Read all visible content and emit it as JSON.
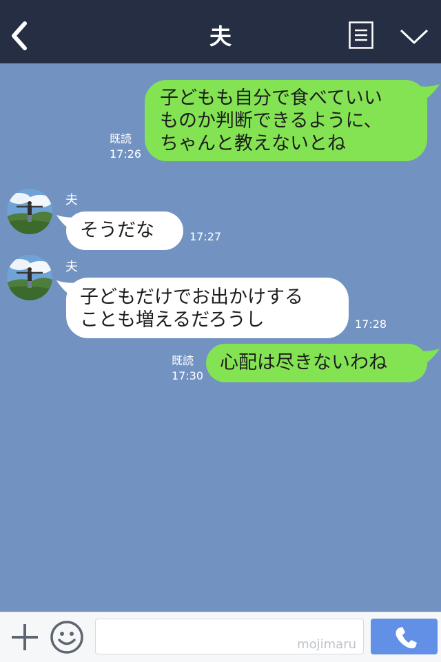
{
  "header": {
    "title": "夫",
    "icons": [
      "back-chevron-icon",
      "menu-list-icon",
      "chevron-down-icon"
    ]
  },
  "messages": [
    {
      "direction": "sent",
      "lines": [
        "子どもも自分で食べていい",
        "ものか判断できるように、",
        "ちゃんと教えないとね"
      ],
      "read": "既読",
      "time": "17:26"
    },
    {
      "direction": "received",
      "sender": "夫",
      "lines": [
        "そうだな"
      ],
      "time": "17:27"
    },
    {
      "direction": "received",
      "sender": "夫",
      "lines": [
        "子どもだけでお出かけする",
        "ことも増えるだろうし"
      ],
      "time": "17:28"
    },
    {
      "direction": "sent",
      "lines": [
        "心配は尽きないわね"
      ],
      "read": "既読",
      "time": "17:30"
    }
  ],
  "input_bar": {
    "watermark": "mojimaru",
    "icons": [
      "plus-icon",
      "smiley-icon",
      "phone-icon"
    ]
  },
  "colors": {
    "background": "#7293c2",
    "header": "#262e44",
    "sent_bubble": "#84e352",
    "received_bubble": "#ffffff",
    "call_button": "#6190e6"
  }
}
